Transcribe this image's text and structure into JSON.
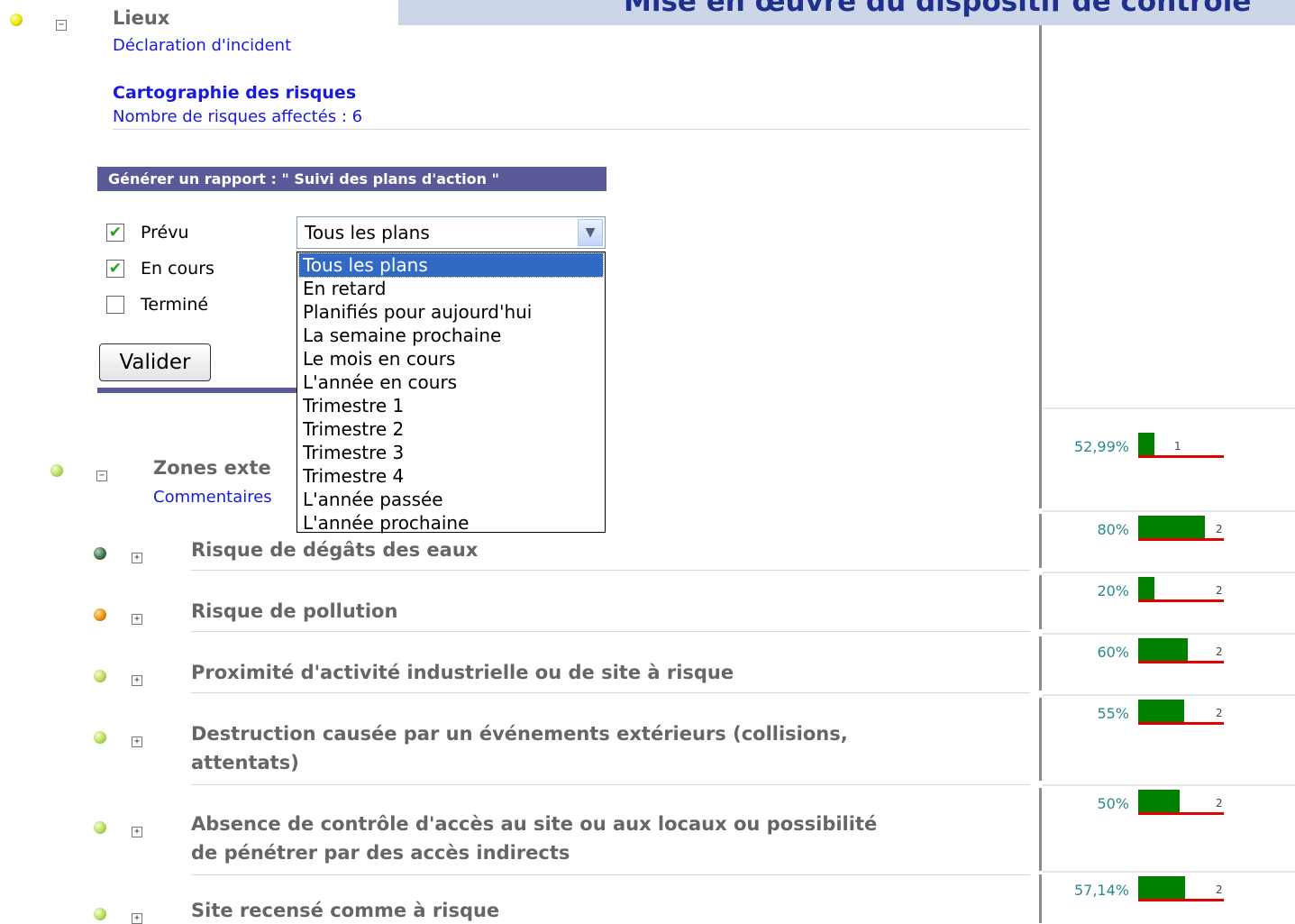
{
  "banner": {
    "title": "Mise en œuvre du dispositif de contrôle"
  },
  "lieux": {
    "title": "Lieux",
    "declaration_link": "Déclaration d'incident",
    "cartographie_title": "Cartographie des risques",
    "nombre_risques": "Nombre de risques affectés  : 6"
  },
  "report": {
    "header": "Générer un rapport : \" Suivi des plans d'action \"",
    "checkboxes": [
      {
        "label": "Prévu",
        "checked": true
      },
      {
        "label": "En cours",
        "checked": true
      },
      {
        "label": "Terminé",
        "checked": false
      }
    ],
    "checkmark": "✔",
    "validate_label": "Valider",
    "select": {
      "value": "Tous les plans",
      "arrow": "▼",
      "options": [
        "Tous les plans",
        "En retard",
        "Planifiés pour aujourd'hui",
        "La semaine prochaine",
        "Le mois en cours",
        "L'année en cours",
        "Trimestre 1",
        "Trimestre 2",
        "Trimestre 3",
        "Trimestre 4",
        "L'année passée",
        "L'année prochaine"
      ],
      "selected_index": 0
    }
  },
  "zones": {
    "title": "Zones exte",
    "comment_link": "Commentaires",
    "percent": "52,99%",
    "progress": 0.2,
    "count": "1"
  },
  "toggle_minus": "−",
  "toggle_plus": "+",
  "risks": [
    {
      "title": [
        "Risque de dégâts des eaux"
      ],
      "bullet": "dark",
      "percent": "80%",
      "progress": 0.8,
      "count": "2"
    },
    {
      "title": [
        "Risque de pollution"
      ],
      "bullet": "orange",
      "percent": "20%",
      "progress": 0.2,
      "count": "2"
    },
    {
      "title": [
        "Proximité d'activité industrielle ou de site à risque"
      ],
      "bullet": "green",
      "percent": "60%",
      "progress": 0.6,
      "count": "2"
    },
    {
      "title": [
        "Destruction causée par un événements extérieurs (collisions,",
        "attentats)"
      ],
      "bullet": "green",
      "percent": "55%",
      "progress": 0.55,
      "count": "2"
    },
    {
      "title": [
        "Absence de contrôle d'accès au site ou aux locaux ou possibilité",
        "de pénétrer par des accès indirects"
      ],
      "bullet": "green",
      "percent": "50%",
      "progress": 0.5,
      "count": "2"
    },
    {
      "title": [
        "Site recensé comme à risque"
      ],
      "bullet": "green",
      "percent": "57,14%",
      "progress": 0.57,
      "count": "2"
    }
  ],
  "colors": {
    "banner_bg": "#cdd6e9",
    "banner_text": "#1f2f8c",
    "report_header_bg": "#5a5a99",
    "link_blue": "#1a1adc",
    "bar_green": "#008000",
    "bar_red": "#e00000",
    "selected_option_bg": "#316ac5"
  }
}
